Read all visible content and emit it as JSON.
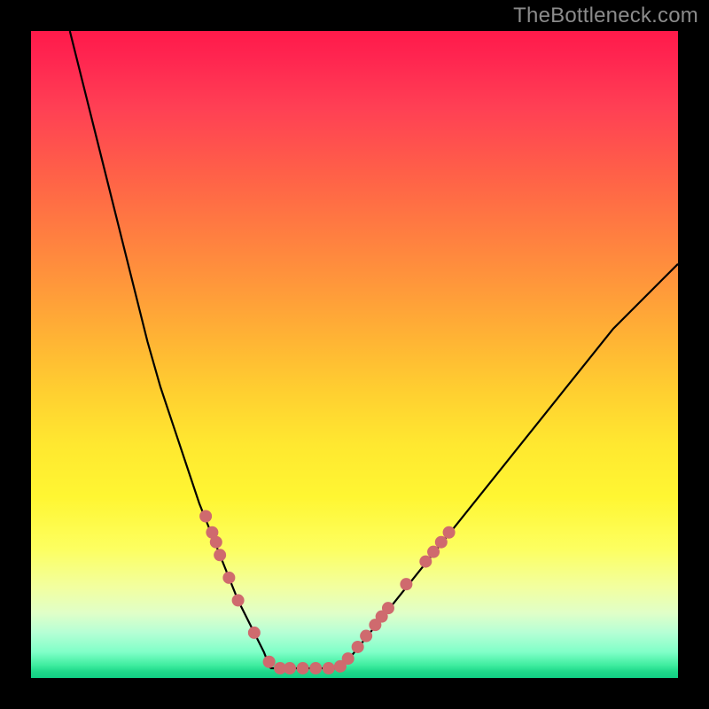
{
  "watermark": "TheBottleneck.com",
  "colors": {
    "dot_fill": "#cf6a6e",
    "curve_stroke": "#000000",
    "background": "#000000"
  },
  "chart_data": {
    "type": "line",
    "title": "",
    "xlabel": "",
    "ylabel": "",
    "xlim": [
      0,
      100
    ],
    "ylim": [
      0,
      100
    ],
    "series": [
      {
        "name": "left_branch",
        "x": [
          6,
          8,
          10,
          12,
          14,
          16,
          18,
          20,
          22,
          24,
          26,
          28,
          30,
          32,
          34,
          36,
          37
        ],
        "y": [
          100,
          92,
          84,
          76,
          68,
          60,
          52,
          45,
          39,
          33,
          27,
          22,
          17,
          12,
          8,
          4,
          1.5
        ]
      },
      {
        "name": "flat_bottom",
        "x": [
          37,
          40,
          44,
          48
        ],
        "y": [
          1.5,
          1.5,
          1.5,
          1.5
        ]
      },
      {
        "name": "right_branch",
        "x": [
          48,
          50,
          54,
          58,
          62,
          66,
          70,
          74,
          78,
          82,
          86,
          90,
          94,
          98,
          100
        ],
        "y": [
          1.5,
          4,
          9,
          14,
          19,
          24,
          29,
          34,
          39,
          44,
          49,
          54,
          58,
          62,
          64
        ]
      }
    ],
    "markers": [
      {
        "x": 27.0,
        "y": 25.0
      },
      {
        "x": 28.0,
        "y": 22.5
      },
      {
        "x": 28.6,
        "y": 21.0
      },
      {
        "x": 29.2,
        "y": 19.0
      },
      {
        "x": 30.6,
        "y": 15.5
      },
      {
        "x": 32.0,
        "y": 12.0
      },
      {
        "x": 34.5,
        "y": 7.0
      },
      {
        "x": 36.8,
        "y": 2.5
      },
      {
        "x": 38.5,
        "y": 1.5
      },
      {
        "x": 40.0,
        "y": 1.5
      },
      {
        "x": 42.0,
        "y": 1.5
      },
      {
        "x": 44.0,
        "y": 1.5
      },
      {
        "x": 46.0,
        "y": 1.5
      },
      {
        "x": 47.8,
        "y": 1.8
      },
      {
        "x": 49.0,
        "y": 3.0
      },
      {
        "x": 50.5,
        "y": 4.8
      },
      {
        "x": 51.8,
        "y": 6.5
      },
      {
        "x": 53.2,
        "y": 8.2
      },
      {
        "x": 54.2,
        "y": 9.5
      },
      {
        "x": 55.2,
        "y": 10.8
      },
      {
        "x": 58.0,
        "y": 14.5
      },
      {
        "x": 61.0,
        "y": 18.0
      },
      {
        "x": 62.2,
        "y": 19.5
      },
      {
        "x": 63.4,
        "y": 21.0
      },
      {
        "x": 64.6,
        "y": 22.5
      }
    ],
    "marker_radius_px": 7
  }
}
